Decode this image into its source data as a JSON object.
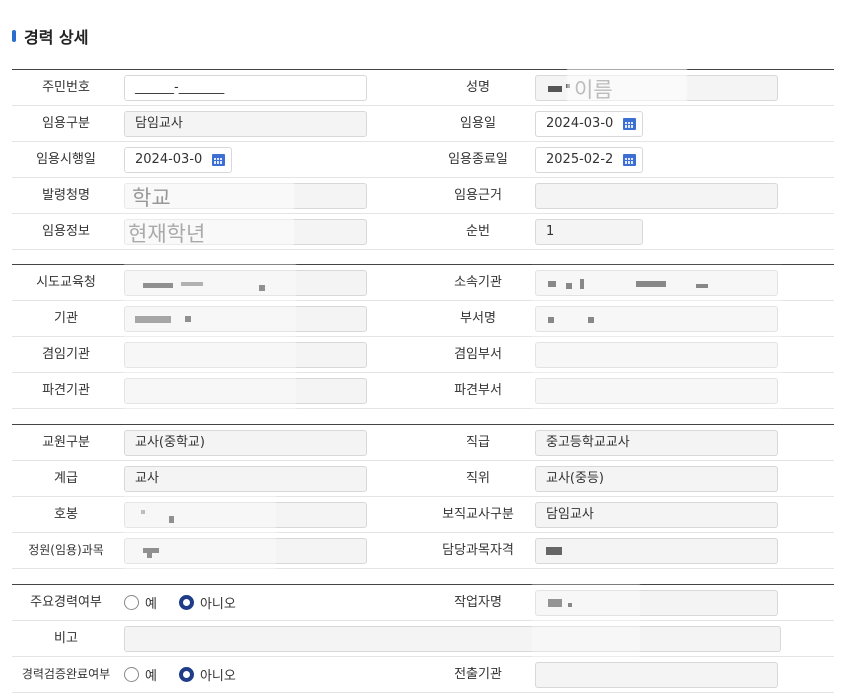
{
  "page": {
    "title": "경력 상세"
  },
  "g1": {
    "rrn_label": "주민번호",
    "rrn_value": "______-_______",
    "name_label": "성명",
    "name_overlay": "이름",
    "type_label": "임용구분",
    "type_value": "담임교사",
    "date_label": "임용일",
    "date_value": "2024-03-0",
    "start_label": "임용시행일",
    "start_value": "2024-03-0",
    "end_label": "임용종료일",
    "end_value": "2025-02-2",
    "issuer_label": "발령청명",
    "issuer_overlay": "학교",
    "basis_label": "임용근거",
    "basis_value": "",
    "info_label": "임용정보",
    "info_overlay": "현재학년",
    "seq_label": "순번",
    "seq_value": "1"
  },
  "g2": {
    "office_label": "시도교육청",
    "affil_label": "소속기관",
    "inst_label": "기관",
    "dept_label": "부서명",
    "cinst_label": "겸임기관",
    "cdept_label": "겸임부서",
    "dinst_label": "파견기관",
    "ddept_label": "파견부서"
  },
  "g3": {
    "kind_label": "교원구분",
    "kind_value": "교사(중학교)",
    "grade_label": "직급",
    "grade_value": "중고등학교교사",
    "rank_label": "계급",
    "rank_value": "교사",
    "pos_label": "직위",
    "pos_value": "교사(중등)",
    "step_label": "호봉",
    "duty_label": "보직교사구분",
    "duty_value": "담임교사",
    "subj_label": "정원(임용)과목",
    "qual_label": "담당과목자격"
  },
  "g4": {
    "major_label": "주요경력여부",
    "yes": "예",
    "no": "아니오",
    "writer_label": "작업자명",
    "note_label": "비고",
    "verify_label": "경력검증완료여부",
    "submit_label": "전출기관"
  },
  "colors": {
    "accent": "#2a6dcc",
    "radio_on": "#1f3c88"
  }
}
